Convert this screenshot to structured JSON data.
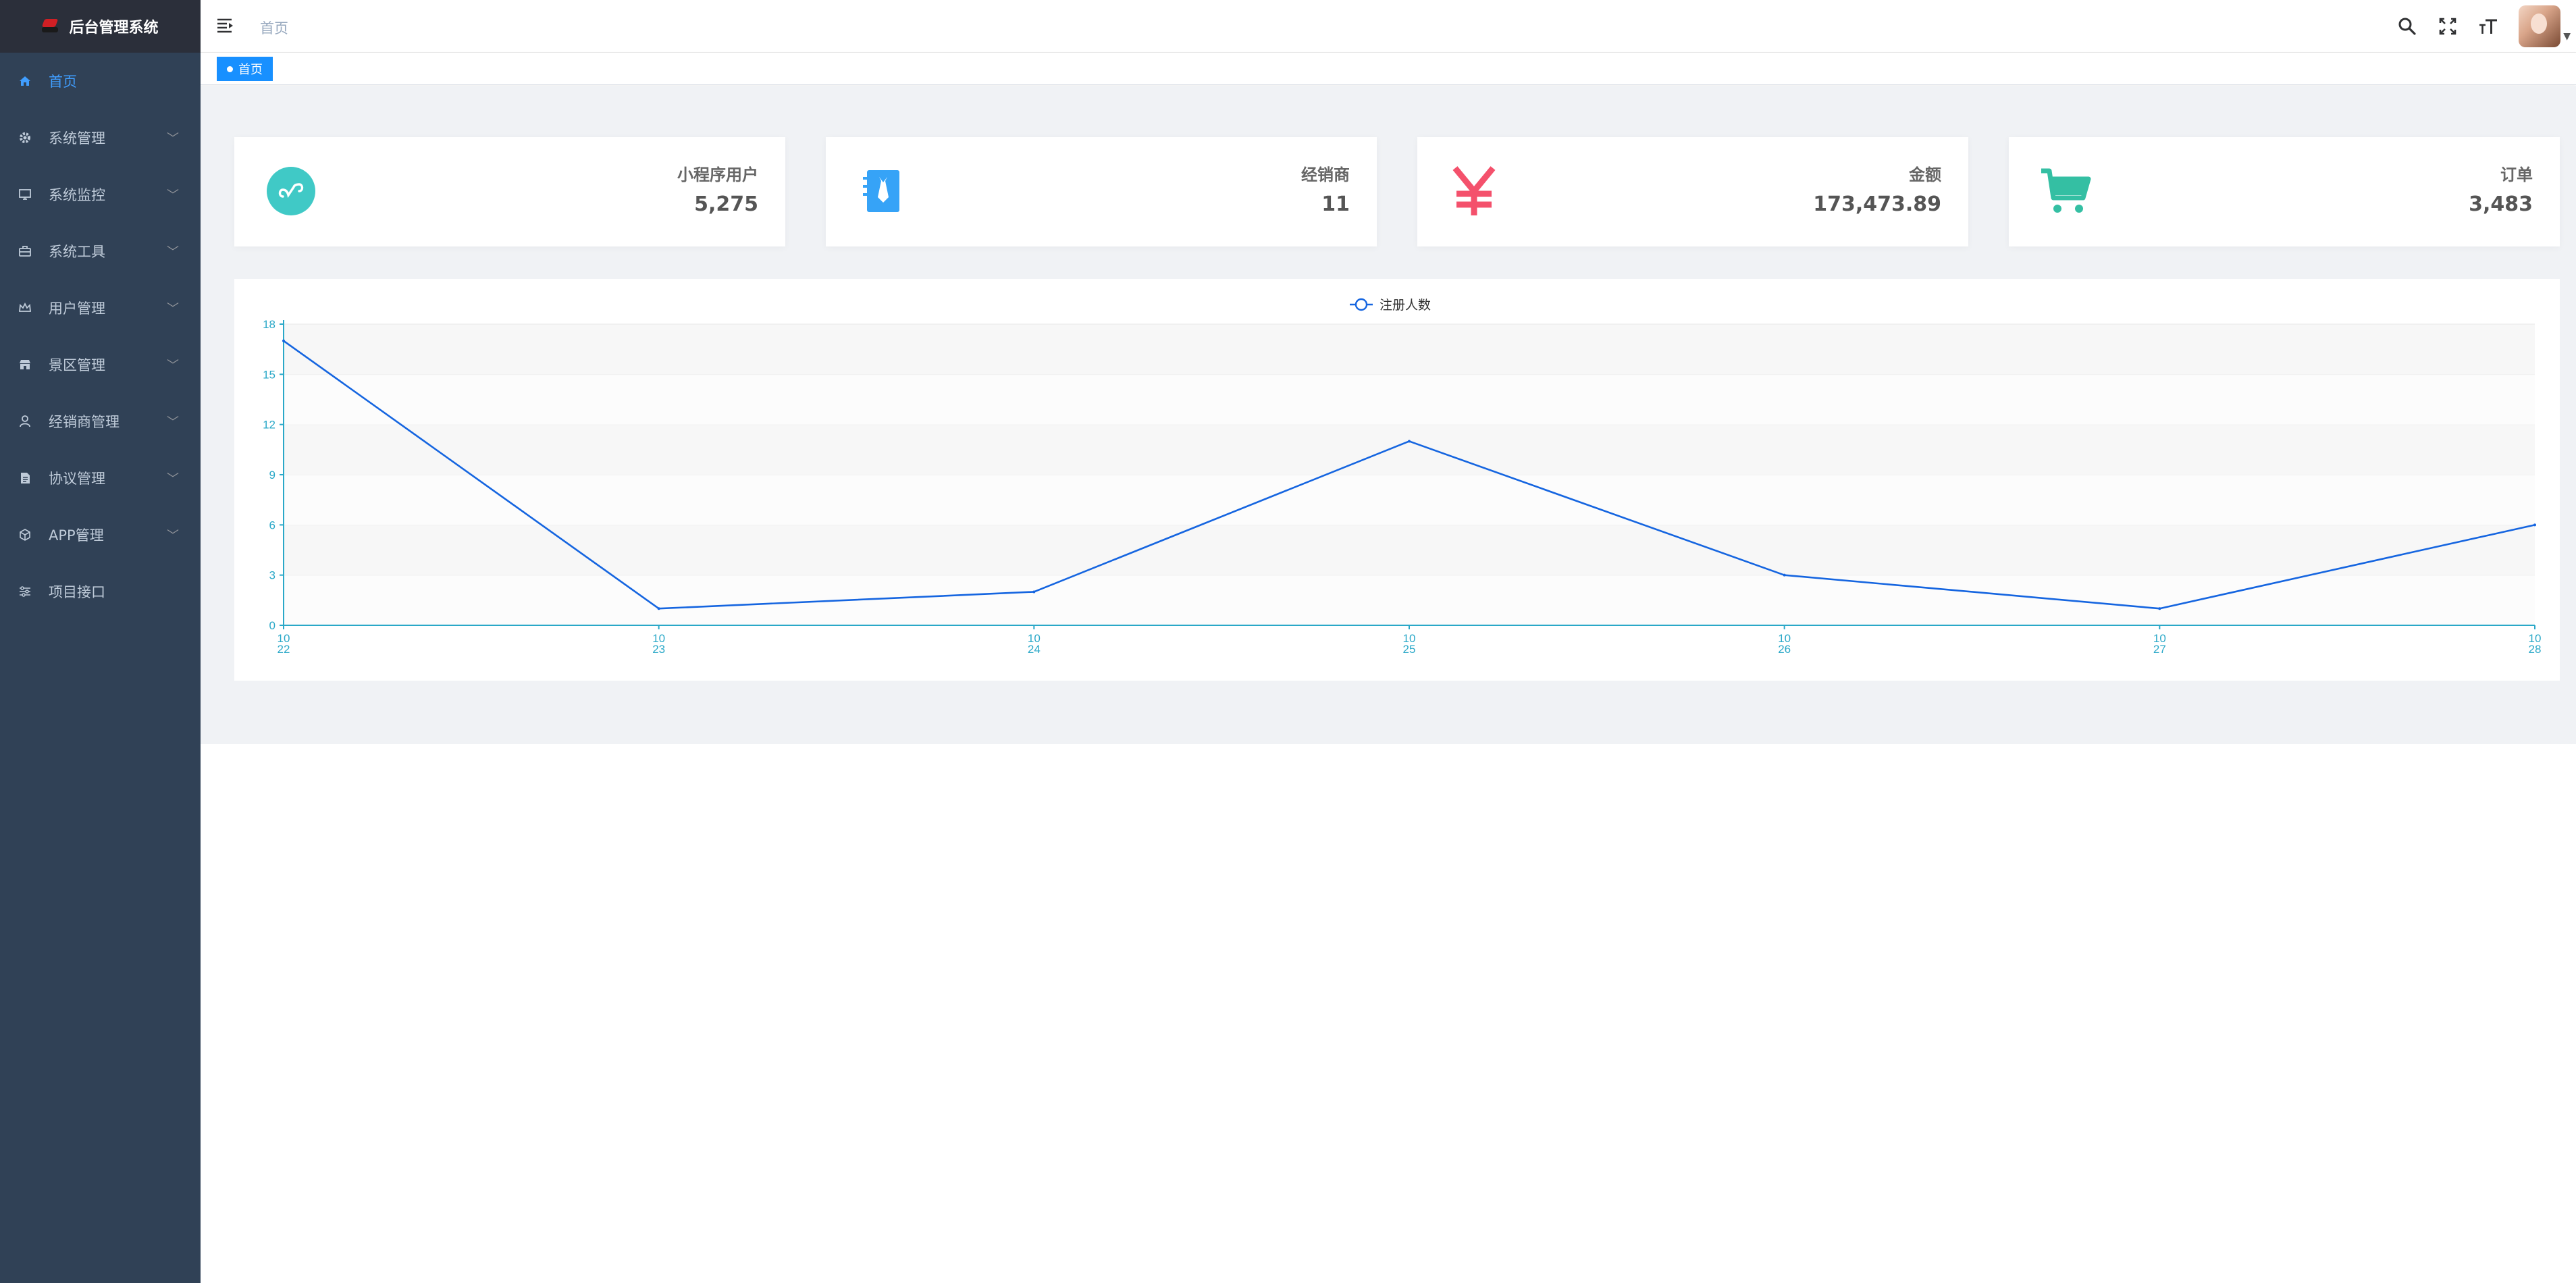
{
  "app": {
    "title": "后台管理系统"
  },
  "sidebar": {
    "items": [
      {
        "label": "首页",
        "icon": "home-icon",
        "active": true,
        "has_children": false
      },
      {
        "label": "系统管理",
        "icon": "gear-icon",
        "active": false,
        "has_children": true
      },
      {
        "label": "系统监控",
        "icon": "monitor-icon",
        "active": false,
        "has_children": true
      },
      {
        "label": "系统工具",
        "icon": "toolbox-icon",
        "active": false,
        "has_children": true
      },
      {
        "label": "用户管理",
        "icon": "crown-icon",
        "active": false,
        "has_children": true
      },
      {
        "label": "景区管理",
        "icon": "store-icon",
        "active": false,
        "has_children": true
      },
      {
        "label": "经销商管理",
        "icon": "user-icon",
        "active": false,
        "has_children": true
      },
      {
        "label": "协议管理",
        "icon": "document-icon",
        "active": false,
        "has_children": true
      },
      {
        "label": "APP管理",
        "icon": "cube-icon",
        "active": false,
        "has_children": true
      },
      {
        "label": "项目接口",
        "icon": "sliders-icon",
        "active": false,
        "has_children": false
      }
    ]
  },
  "header": {
    "breadcrumb": "首页",
    "tools": [
      "search-icon",
      "fullscreen-icon",
      "font-size-icon"
    ]
  },
  "tags": {
    "active": "首页"
  },
  "cards": [
    {
      "label": "小程序用户",
      "value": "5,275",
      "icon": "mini-program-icon",
      "color": "#40c9c6"
    },
    {
      "label": "经销商",
      "value": "11",
      "icon": "dealer-icon",
      "color": "#36a3f7"
    },
    {
      "label": "金额",
      "value": "173,473.89",
      "icon": "yen-icon",
      "color": "#f4516c"
    },
    {
      "label": "订单",
      "value": "3,483",
      "icon": "cart-icon",
      "color": "#34bfa3"
    }
  ],
  "chart_data": {
    "type": "line",
    "legend": "注册人数",
    "legend_position": "top-center",
    "categories": [
      [
        "10",
        "22"
      ],
      [
        "10",
        "23"
      ],
      [
        "10",
        "24"
      ],
      [
        "10",
        "25"
      ],
      [
        "10",
        "26"
      ],
      [
        "10",
        "27"
      ],
      [
        "10",
        "28"
      ]
    ],
    "series": [
      {
        "name": "注册人数",
        "values": [
          17,
          1,
          2,
          11,
          3,
          1,
          6
        ],
        "color": "#1565e0"
      }
    ],
    "ylim": [
      0,
      18
    ],
    "yticks": [
      "0",
      "3",
      "6",
      "9",
      "12",
      "15",
      "18"
    ],
    "grid": "banded",
    "axis_color": "#2aa8c8"
  }
}
